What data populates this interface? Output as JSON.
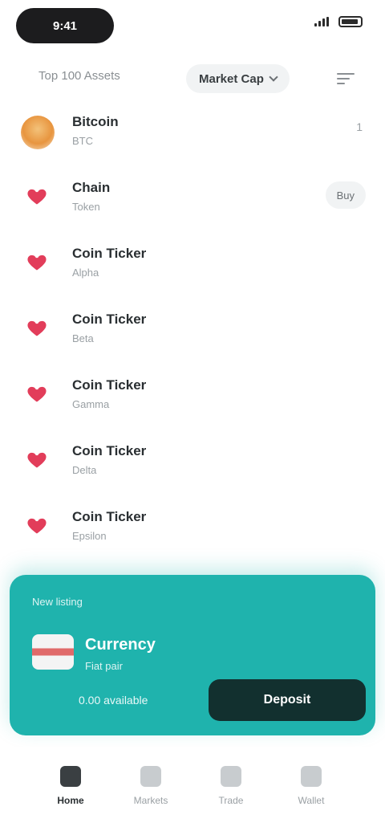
{
  "status_bar": {
    "time": "9:41"
  },
  "filter_bar": {
    "label": "Top 100 Assets",
    "sort_label": "Market Cap"
  },
  "rows": [
    {
      "title": "Bitcoin",
      "subtitle": "BTC",
      "meta": "1",
      "type": "avatar"
    },
    {
      "title": "Chain",
      "subtitle": "Token",
      "meta": "Buy",
      "type": "pill"
    },
    {
      "title": "Coin Ticker",
      "subtitle": "Alpha",
      "meta": "",
      "type": "plain"
    },
    {
      "title": "Coin Ticker",
      "subtitle": "Beta",
      "meta": "",
      "type": "plain"
    },
    {
      "title": "Coin Ticker",
      "subtitle": "Gamma",
      "meta": "",
      "type": "plain"
    },
    {
      "title": "Coin Ticker",
      "subtitle": "Delta",
      "meta": "",
      "type": "plain"
    },
    {
      "title": "Coin Ticker",
      "subtitle": "Epsilon",
      "meta": "",
      "type": "plain"
    }
  ],
  "card": {
    "eyebrow": "New listing",
    "title": "Currency",
    "subtitle": "Fiat pair",
    "detail": "0.00 available",
    "button_label": "Deposit"
  },
  "bottom_nav": [
    {
      "label": "Home"
    },
    {
      "label": "Markets"
    },
    {
      "label": "Trade"
    },
    {
      "label": "Wallet"
    }
  ],
  "colors": {
    "accent": "#1fb3ad",
    "button_dark": "#12302f",
    "list_icon": "#e23d5a"
  }
}
